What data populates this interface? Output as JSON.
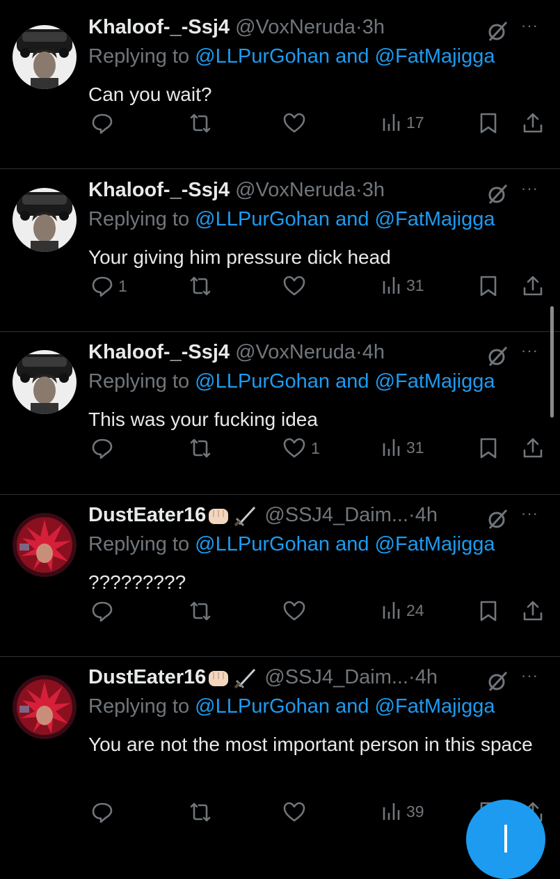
{
  "tweets": [
    {
      "name": "Khaloof-_-Ssj4",
      "handle": "@VoxNeruda",
      "time": "3h",
      "replying_prefix": "Replying to ",
      "mention1": "@LLPurGohan",
      "and": " and ",
      "mention2": "@FatMajigga",
      "text": "Can you wait?",
      "replies": "",
      "reposts": "",
      "likes": "",
      "views": "17",
      "avatar": "car-person-avatar"
    },
    {
      "name": "Khaloof-_-Ssj4",
      "handle": "@VoxNeruda",
      "time": "3h",
      "replying_prefix": "Replying to ",
      "mention1": "@LLPurGohan",
      "and": " and ",
      "mention2": "@FatMajigga",
      "text": "Your giving him pressure dick head",
      "replies": "1",
      "reposts": "",
      "likes": "",
      "views": "31",
      "avatar": "car-person-avatar"
    },
    {
      "name": "Khaloof-_-Ssj4",
      "handle": "@VoxNeruda",
      "time": "4h",
      "replying_prefix": "Replying to ",
      "mention1": "@LLPurGohan",
      "and": " and ",
      "mention2": "@FatMajigga",
      "text": "This was your fucking idea",
      "replies": "",
      "reposts": "",
      "likes": "1",
      "views": "31",
      "avatar": "car-person-avatar"
    },
    {
      "name": "DustEater16",
      "handle": "@SSJ4_Daim...",
      "time": "4h",
      "replying_prefix": "Replying to ",
      "mention1": "@LLPurGohan",
      "and": " and ",
      "mention2": "@FatMajigga",
      "text": "?????????",
      "replies": "",
      "reposts": "",
      "likes": "",
      "views": "24",
      "avatar": "red-aura-avatar"
    },
    {
      "name": "DustEater16",
      "handle": "@SSJ4_Daim...",
      "time": "4h",
      "replying_prefix": "Replying to ",
      "mention1": "@LLPurGohan",
      "and": " and ",
      "mention2": "@FatMajigga",
      "text": "You are not the most important person in this space",
      "replies": "",
      "reposts": "",
      "likes": "",
      "views": "39",
      "avatar": "red-aura-avatar"
    }
  ],
  "separator_dot": "·",
  "more_glyph": "···",
  "name_emojis": [
    "fist-emoji",
    "dagger-emoji"
  ],
  "fab_icon": "plus-icon",
  "colors": {
    "background": "#000000",
    "text": "#e7e9ea",
    "muted": "#71767b",
    "accent": "#1d9bf0",
    "divider": "#2f3336"
  }
}
